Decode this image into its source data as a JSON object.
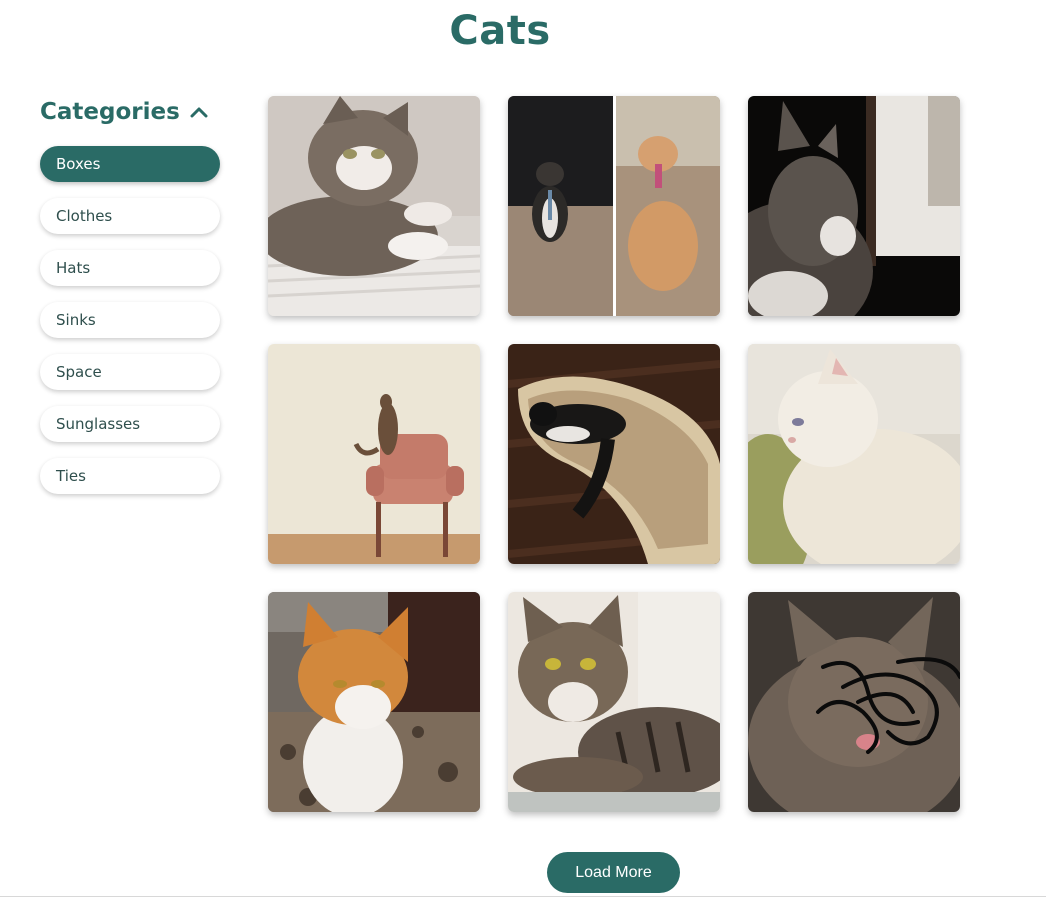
{
  "page": {
    "title": "Cats"
  },
  "sidebar": {
    "heading": "Categories",
    "toggle_icon": "chevron-up-icon",
    "categories": [
      {
        "label": "Boxes",
        "active": true
      },
      {
        "label": "Clothes",
        "active": false
      },
      {
        "label": "Hats",
        "active": false
      },
      {
        "label": "Sinks",
        "active": false
      },
      {
        "label": "Space",
        "active": false
      },
      {
        "label": "Sunglasses",
        "active": false
      },
      {
        "label": "Ties",
        "active": false
      }
    ]
  },
  "gallery": {
    "images": [
      {
        "name": "cat-photo-1",
        "alt": "tabby cat lying on white radiator"
      },
      {
        "name": "cat-photo-2",
        "alt": "two cats wearing ties"
      },
      {
        "name": "cat-photo-3",
        "alt": "tabby cat by window in dark room"
      },
      {
        "name": "cat-photo-4",
        "alt": "cat climbing pink armchair"
      },
      {
        "name": "cat-photo-5",
        "alt": "black and white cat in guitar case"
      },
      {
        "name": "cat-photo-6",
        "alt": "fluffy white cat"
      },
      {
        "name": "cat-photo-7",
        "alt": "orange and white cat on rug"
      },
      {
        "name": "cat-photo-8",
        "alt": "tabby cat lying down"
      },
      {
        "name": "cat-photo-9",
        "alt": "long-haired tabby cat with scribble"
      }
    ]
  },
  "actions": {
    "load_more_label": "Load More"
  },
  "colors": {
    "accent": "#2a6b66",
    "text": "#2f4f4d",
    "background": "#ffffff"
  }
}
